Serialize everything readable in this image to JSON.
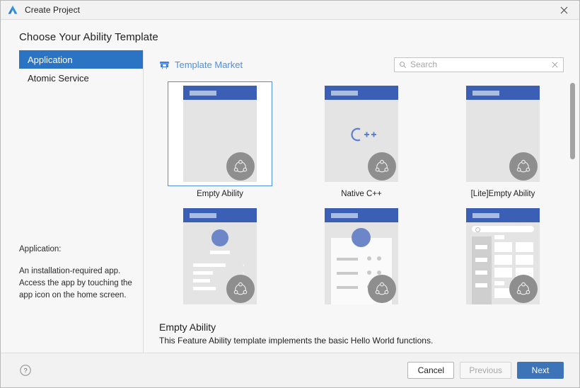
{
  "window": {
    "title": "Create Project",
    "logo_icon": "deveco-logo-icon",
    "close_icon": "close-icon"
  },
  "heading": "Choose Your Ability Template",
  "sidebar": {
    "items": [
      {
        "label": "Application",
        "selected": true
      },
      {
        "label": "Atomic Service",
        "selected": false
      }
    ],
    "description": {
      "lead": "Application:",
      "body": "An installation-required app. Access the app by touching the app icon on the home screen."
    }
  },
  "toolbar": {
    "market_label": "Template Market",
    "market_icon": "storefront-icon",
    "search": {
      "placeholder": "Search",
      "value": "",
      "search_icon": "search-icon",
      "clear_icon": "clear-icon"
    }
  },
  "templates": [
    {
      "label": "Empty Ability",
      "kind": "plain",
      "selected": true
    },
    {
      "label": "Native C++",
      "kind": "cpp",
      "selected": false
    },
    {
      "label": "[Lite]Empty Ability",
      "kind": "plain",
      "selected": false
    },
    {
      "label": "",
      "kind": "settings-list",
      "selected": false
    },
    {
      "label": "",
      "kind": "profile-card",
      "selected": false
    },
    {
      "label": "",
      "kind": "category-grid",
      "selected": false
    }
  ],
  "detail": {
    "title": "Empty Ability",
    "description": "This Feature Ability template implements the basic Hello World functions."
  },
  "footer": {
    "help_icon": "help-icon",
    "cancel_label": "Cancel",
    "previous_label": "Previous",
    "next_label": "Next"
  },
  "colors": {
    "accent": "#3d74b8",
    "selection": "#2b74c4",
    "link": "#4e8fe0",
    "thumb_header": "#3b5fb5",
    "window_bg": "#f7f7f7"
  }
}
